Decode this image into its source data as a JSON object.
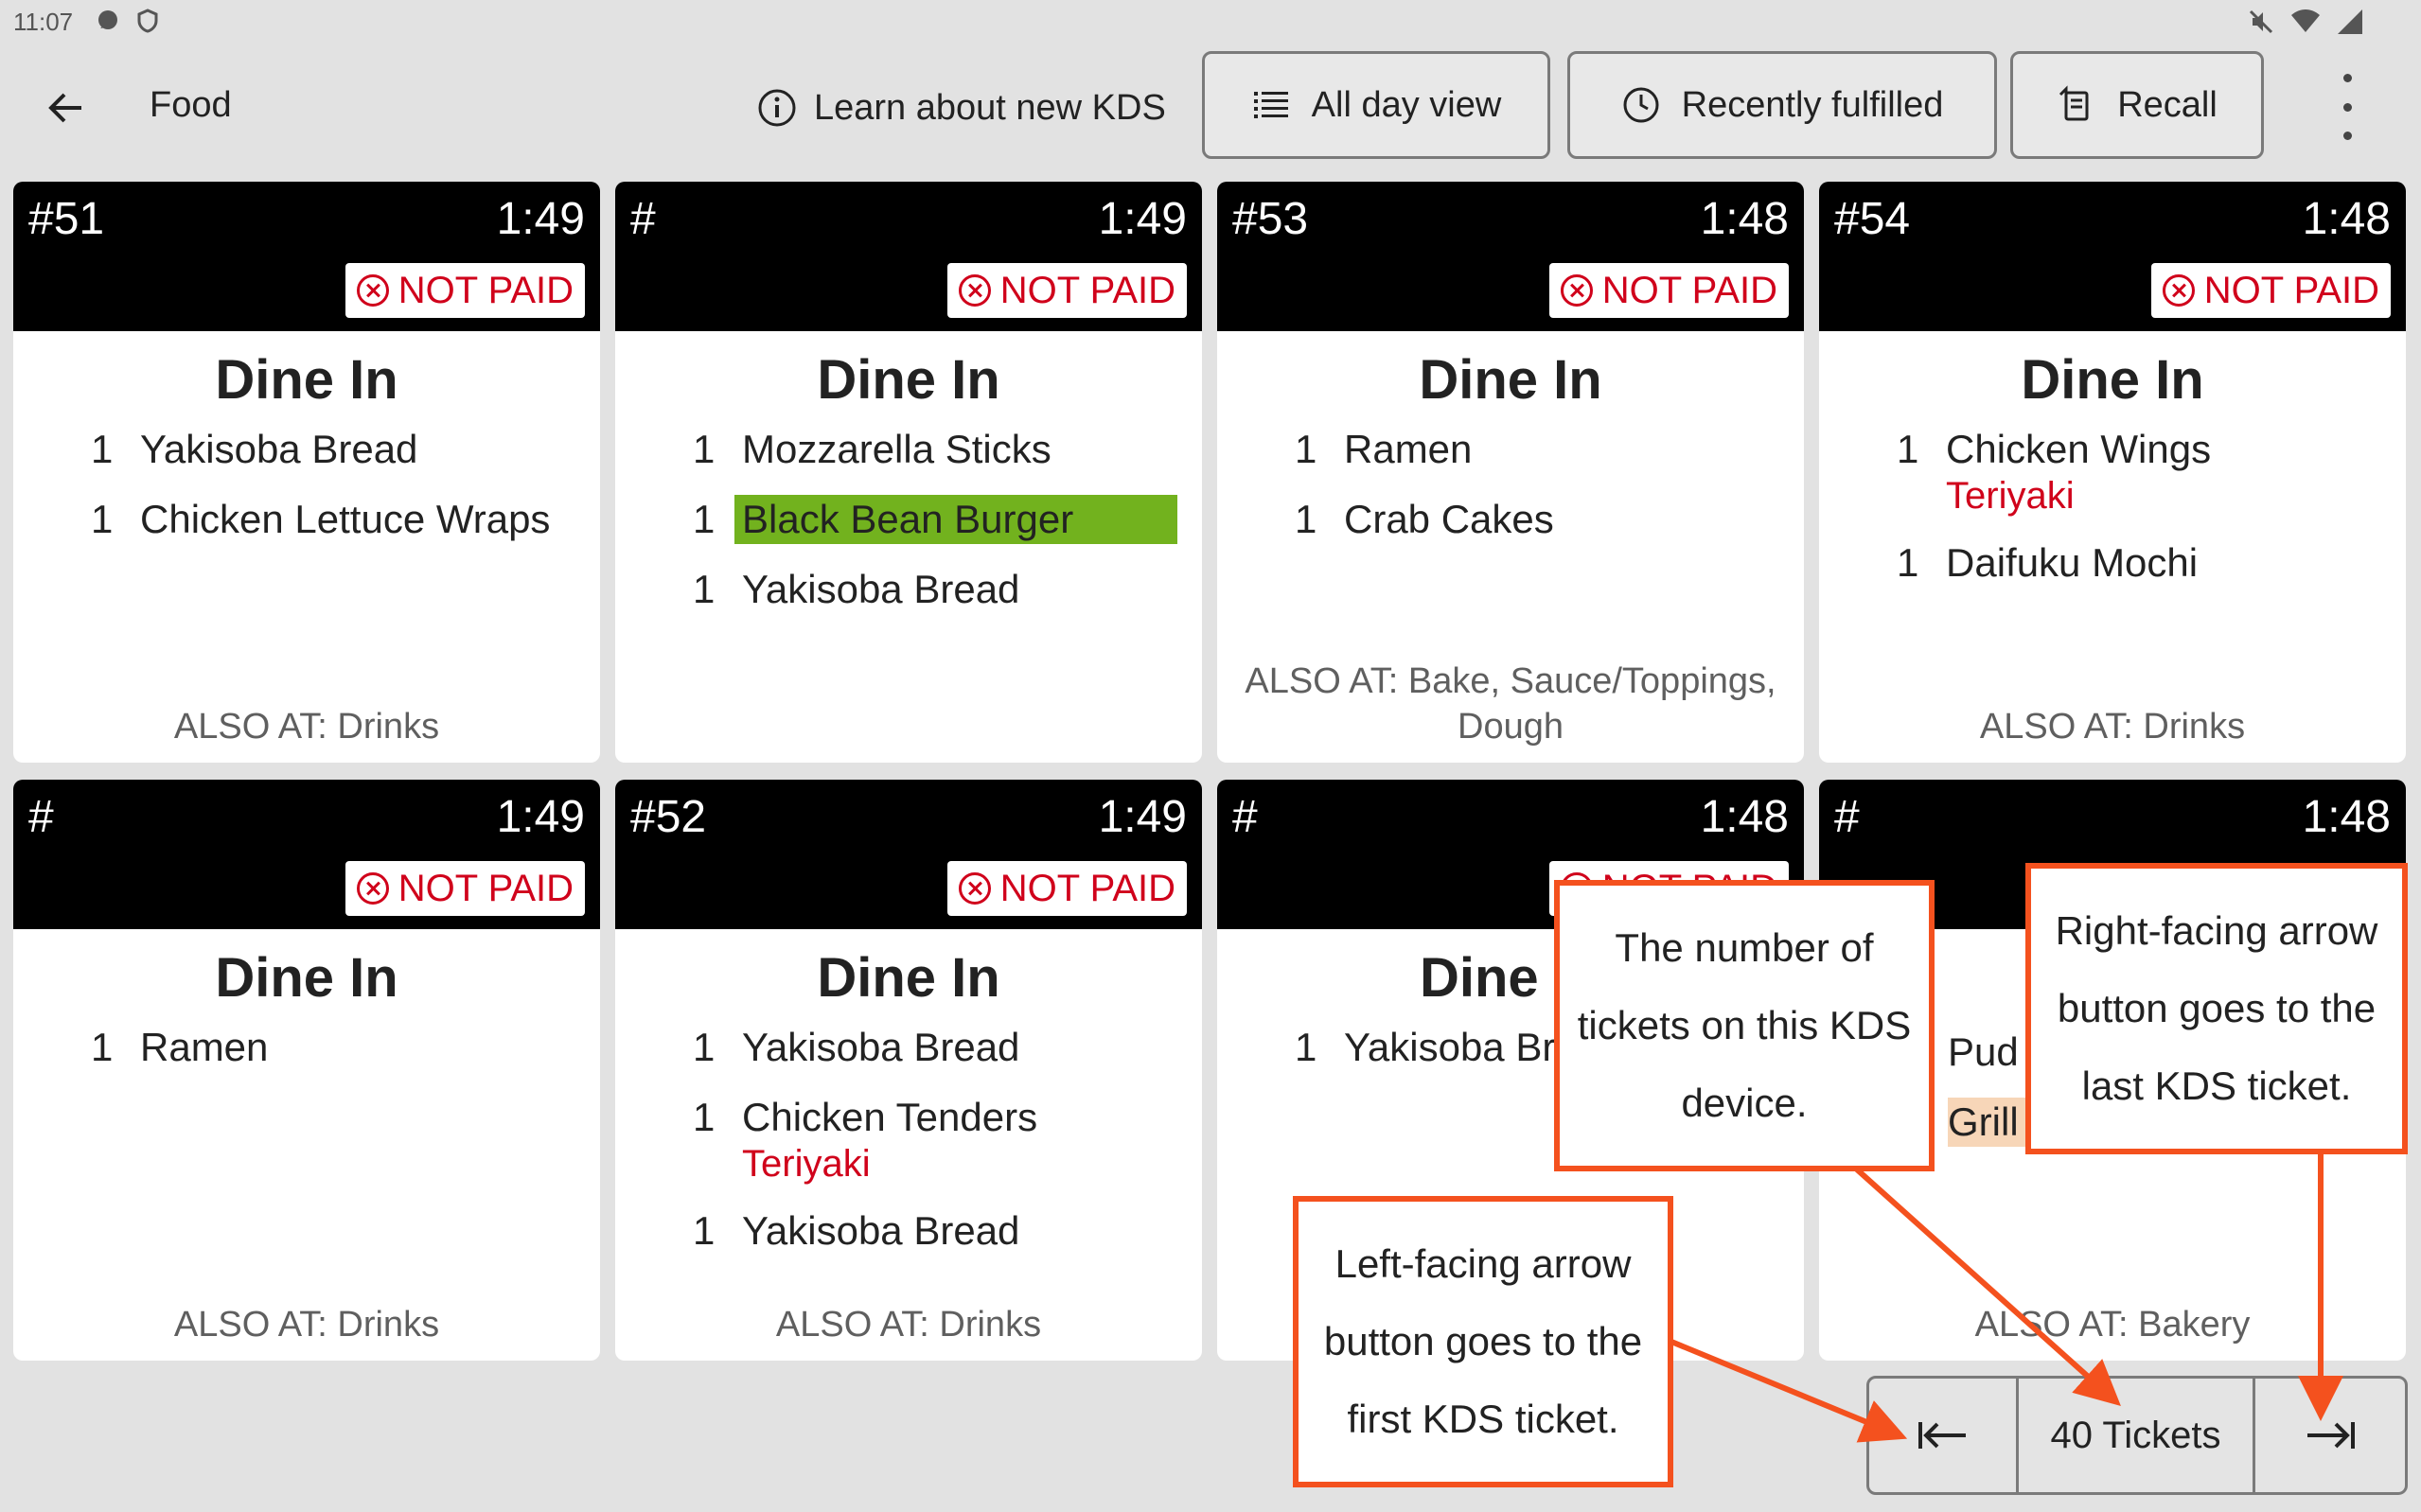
{
  "status_bar": {
    "time": "11:07"
  },
  "header": {
    "title": "Food",
    "learn_label": "Learn about new KDS",
    "all_day_label": "All day view",
    "recently_fulfilled_label": "Recently fulfilled",
    "recall_label": "Recall"
  },
  "tickets": [
    {
      "number": "#51",
      "time": "1:49",
      "status": "NOT PAID",
      "mode": "Dine In",
      "items": [
        {
          "qty": "1",
          "name": "Yakisoba Bread"
        },
        {
          "qty": "1",
          "name": "Chicken Lettuce Wraps"
        }
      ],
      "also_at": "ALSO AT: Drinks"
    },
    {
      "number": "#",
      "time": "1:49",
      "status": "NOT PAID",
      "mode": "Dine In",
      "items": [
        {
          "qty": "1",
          "name": "Mozzarella Sticks"
        },
        {
          "qty": "1",
          "name": "Black Bean Burger"
        },
        {
          "qty": "1",
          "name": "Yakisoba Bread"
        }
      ],
      "also_at": ""
    },
    {
      "number": "#53",
      "time": "1:48",
      "status": "NOT PAID",
      "mode": "Dine In",
      "items": [
        {
          "qty": "1",
          "name": "Ramen"
        },
        {
          "qty": "1",
          "name": "Crab Cakes"
        }
      ],
      "also_at_line1": "ALSO AT: Bake, Sauce/Toppings,",
      "also_at_line2": "Dough"
    },
    {
      "number": "#54",
      "time": "1:48",
      "status": "NOT PAID",
      "mode": "Dine In",
      "items": [
        {
          "qty": "1",
          "name": "Chicken Wings",
          "modifier": "Teriyaki"
        },
        {
          "qty": "1",
          "name": "Daifuku Mochi"
        }
      ],
      "also_at": "ALSO AT: Drinks"
    },
    {
      "number": "#",
      "time": "1:49",
      "status": "NOT PAID",
      "mode": "Dine In",
      "items": [
        {
          "qty": "1",
          "name": "Ramen"
        }
      ],
      "also_at": "ALSO AT: Drinks"
    },
    {
      "number": "#52",
      "time": "1:49",
      "status": "NOT PAID",
      "mode": "Dine In",
      "items": [
        {
          "qty": "1",
          "name": "Yakisoba Bread"
        },
        {
          "qty": "1",
          "name": "Chicken Tenders",
          "modifier": "Teriyaki"
        },
        {
          "qty": "1",
          "name": "Yakisoba Bread"
        }
      ],
      "also_at": "ALSO AT: Drinks"
    },
    {
      "number": "#",
      "time": "1:48",
      "status": "NOT PAID",
      "mode": "Dine",
      "items": [
        {
          "qty": "1",
          "name": "Yakisoba Br"
        }
      ],
      "also_at": ""
    },
    {
      "number": "#",
      "time": "1:48",
      "status": "",
      "mode": "",
      "items": [
        {
          "qty": "",
          "name": "Pud"
        },
        {
          "qty": "",
          "name": "Grill"
        }
      ],
      "also_at": "ALSO AT: Bakery"
    }
  ],
  "pager": {
    "count_label": "40 Tickets"
  },
  "callouts": {
    "ticket_count_line1": "The number of",
    "ticket_count_line2": "tickets on this KDS",
    "ticket_count_line3": "device.",
    "last_line1": "Right-facing arrow",
    "last_line2": "button goes to the",
    "last_line3": "last KDS ticket.",
    "first_line1": "Left-facing arrow",
    "first_line2": "button goes to the",
    "first_line3": "first KDS ticket."
  },
  "colors": {
    "accent": "#f4511e",
    "not_paid": "#d0021b",
    "highlight_green": "#72b21e",
    "highlight_peach": "#f7d6b8"
  }
}
